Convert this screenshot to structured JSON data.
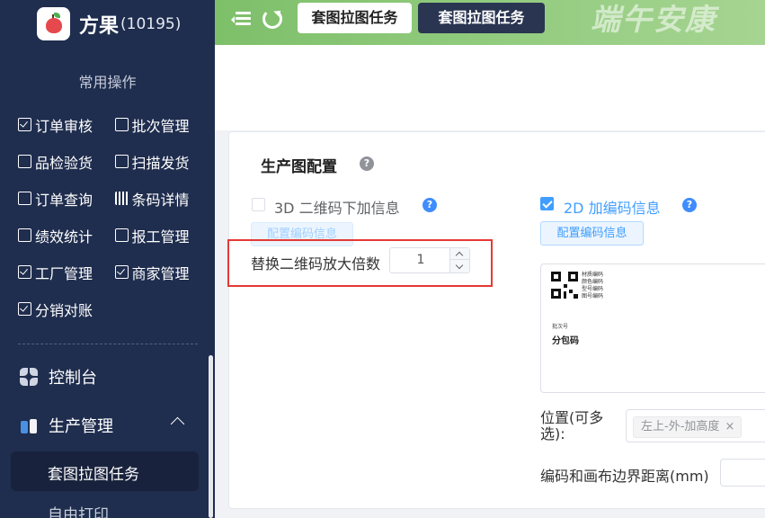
{
  "brand": {
    "name": "方果",
    "count": "(10195)"
  },
  "sidebar": {
    "section_title": "常用操作",
    "quick_ops": [
      [
        "订单审核",
        "批次管理"
      ],
      [
        "品检验货",
        "扫描发货"
      ],
      [
        "订单查询",
        "条码详情"
      ],
      [
        "绩效统计",
        "报工管理"
      ],
      [
        "工厂管理",
        "商家管理"
      ],
      [
        "分销对账"
      ]
    ],
    "nav": {
      "console": "控制台",
      "production": "生产管理",
      "active_item": "套图拉图任务",
      "next_item": "自由打印"
    }
  },
  "topbar": {
    "tabs": [
      "套图拉图任务",
      "套图拉图任务"
    ],
    "banner": "端午安康"
  },
  "panel": {
    "title": "生产图配置",
    "help_symbol": "?",
    "opt_3d": {
      "label": "3D 二维码下加信息",
      "checked": false,
      "button": "配置编码信息"
    },
    "opt_2d": {
      "label": "2D 加编码信息",
      "checked": true,
      "button": "配置编码信息"
    },
    "scale": {
      "label": "替换二维码放大倍数",
      "value": "1"
    },
    "preview": {
      "labels": [
        "材质编码",
        "颜色编码",
        "型号编码",
        "图号编码"
      ],
      "batch_label": "批次号",
      "package_label": "分包码"
    },
    "position": {
      "label": "位置(可多选):",
      "tag": "左上-外-加高度",
      "tag_close": "×"
    },
    "margin": {
      "label": "编码和画布边界距离(mm)",
      "value": ""
    }
  },
  "colors": {
    "sidebar_bg": "#1f2d4e",
    "accent": "#409eff",
    "highlight_box": "#e53935",
    "topbar_green": "#8fca7c"
  }
}
